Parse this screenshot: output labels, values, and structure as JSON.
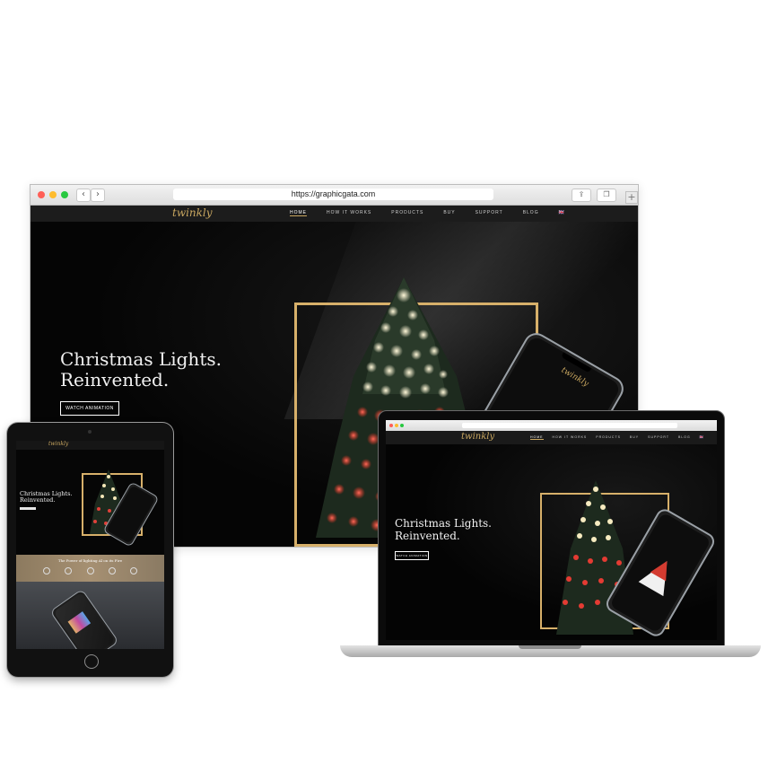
{
  "browser": {
    "url": "https://graphicgata.com",
    "back_icon": "‹",
    "forward_icon": "›",
    "share_icon": "⇪",
    "tabs_icon": "❐",
    "newtab_icon": "+"
  },
  "site": {
    "logo": "twinkly",
    "nav": [
      "HOME",
      "HOW IT WORKS",
      "PRODUCTS",
      "BUY",
      "SUPPORT",
      "BLOG"
    ],
    "flag": "🇬🇧",
    "headline_line1": "Christmas Lights.",
    "headline_line2": "Reinvented.",
    "cta": "WATCH ANIMATION",
    "power_text": "The Power of lighting Al on its Fire",
    "phone_logo": "twinkly"
  },
  "colors": {
    "accent_gold": "#d7b06a",
    "nav_bg": "#1c1c1c",
    "hero_bg": "#050505"
  }
}
